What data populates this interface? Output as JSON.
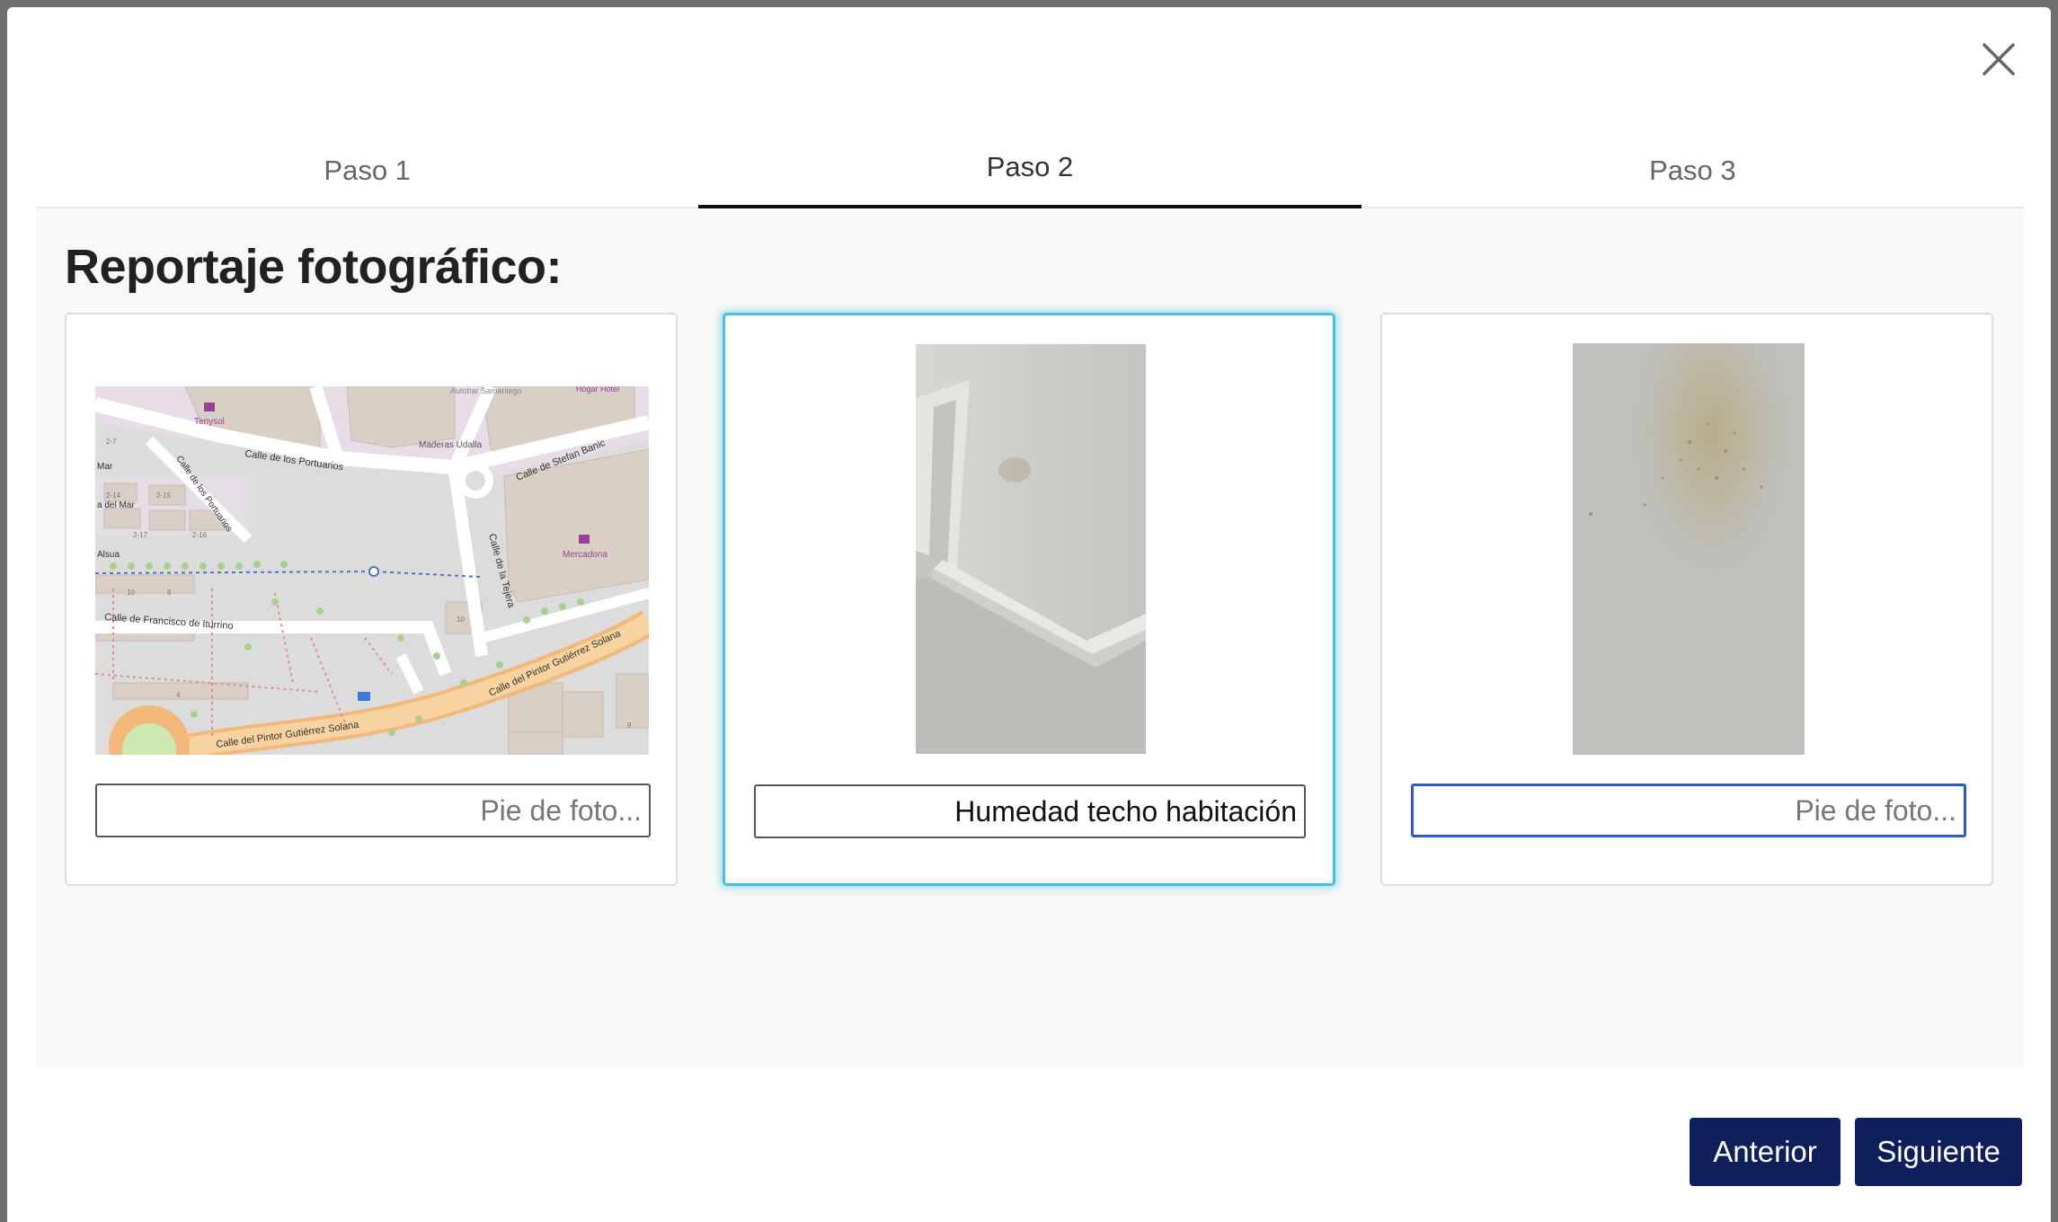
{
  "modal": {
    "close_label": "",
    "tabs": [
      {
        "label": "Paso 1",
        "active": false
      },
      {
        "label": "Paso 2",
        "active": true
      },
      {
        "label": "Paso 3",
        "active": false
      }
    ],
    "title": "Reportaje fotográfico:",
    "photos": [
      {
        "kind": "map",
        "caption_value": "",
        "caption_placeholder": "Pie de foto...",
        "map_labels": {
          "tenysol": "Tenysol",
          "autobar": "Autobar Samaniego",
          "hogar": "Hogar Hotel",
          "maderas": "Maderas Udalla",
          "portuarios": "Calle de los Portuarios",
          "portuarios2": "Calle de los Portuarios",
          "stefan": "Calle de Stefan Banic",
          "mar": "Mar",
          "delmar": "a del Mar",
          "alsua": "Alsua",
          "mercadona": "Mercadona",
          "tejera": "Calle de la Tejera",
          "iturrino": "Calle de Francisco de Iturrino",
          "pintor1": "Calle del Pintor Gutiérrez Solana",
          "pintor2": "Calle del Pintor Gutiérrez Solana",
          "n27": "2-7",
          "n214": "2-14",
          "n215": "2-15",
          "n217": "2-17",
          "n216": "2-16",
          "n10": "10",
          "n10b": "10",
          "n8": "8",
          "n4": "4",
          "n9": "9"
        }
      },
      {
        "kind": "ceiling-photo",
        "caption_value": "Humedad techo habitación",
        "caption_placeholder": "Pie de foto..."
      },
      {
        "kind": "wall-stain-photo",
        "caption_value": "",
        "caption_placeholder": "Pie de foto..."
      }
    ],
    "buttons": {
      "previous": "Anterior",
      "next": "Siguiente"
    }
  },
  "colors": {
    "accent_button": "#0f1f5c",
    "selected_card_border": "#45c2e0",
    "focused_input_border": "#2a5bc8"
  }
}
